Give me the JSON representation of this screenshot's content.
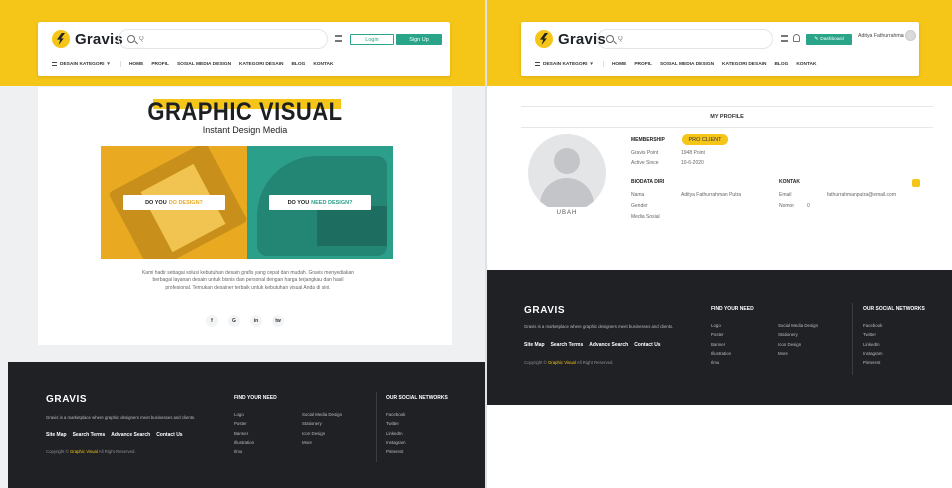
{
  "common": {
    "logo_text": "Gravis",
    "search_placeholder": "Q",
    "menu": {
      "category_label": "DESAIN KATEGORI",
      "items": [
        "HOME",
        "PROFIL",
        "SOSIAL MEDIA DESIGN",
        "KATEGORI DESAIN",
        "BLOG",
        "KONTAK"
      ]
    }
  },
  "left": {
    "header": {
      "login_label": "Login",
      "signup_label": "Sign Up"
    },
    "hero": {
      "title": "GRAPHIC VISUAL",
      "subtitle": "Instant Design Media",
      "tile_a_label": "DO YOU",
      "tile_a_accent": "DO DESIGN?",
      "tile_b_label": "DO YOU",
      "tile_b_accent": "NEED DESIGN?",
      "description": "Kami hadir sebagai solusi kebutuhan desain grafis yang cepat dan mudah. Gravis menyediakan berbagai layanan desain untuk bisnis dan personal dengan harga terjangkau dan hasil profesional. Temukan desainer terbaik untuk kebutuhan visual Anda di sini."
    },
    "socials": [
      "f",
      "G",
      "in",
      "tw"
    ],
    "footer": {
      "logo": "GRAVIS",
      "tagline": "Gravis is a marketplace where graphic designers meet businesses and clients.",
      "links": [
        "Site Map",
        "Search Terms",
        "Advance Search",
        "Contact Us"
      ],
      "copyright_prefix": "Copyright ©",
      "copyright_brand": "Graphic Visual",
      "copyright_suffix": "All Right Reserved.",
      "col_head": "FIND YOUR NEED",
      "col1": [
        "Logo",
        "Poster",
        "Banner",
        "Illustration",
        "Ilmu"
      ],
      "col2": [
        "Social Media Design",
        "Stationery",
        "Icon Design",
        "More"
      ],
      "social_head": "OUR SOCIAL NETWORKS",
      "social_list": [
        "Facebook",
        "Twitter",
        "LinkedIn",
        "Instagram",
        "Pinterest"
      ]
    }
  },
  "right": {
    "header": {
      "dashboard_label": "Dashboard",
      "username": "Aditya Fathurrahman Putra"
    },
    "profile": {
      "title": "MY PROFILE",
      "membership_label": "MEMBERSHIP",
      "membership_value": "PRO CLIENT",
      "row1_key": "Gravis Point",
      "row1_value": "1948 Point",
      "row2_key": "Active Since",
      "row2_value": "10-6-2020",
      "biodata_head": "BIODATA DIRI",
      "name_key": "Nama",
      "name_value": "Aditya Fathurrahman Putra",
      "gender_key": "Gender",
      "media_key": "Media Sosial",
      "contact_head": "KONTAK",
      "email_key": "Email",
      "email_value": "fathurrahmanputra@email.com",
      "phone_key": "Nomor",
      "phone_value": "0",
      "avatar_button": "UBAH"
    },
    "footer": {
      "logo": "GRAVIS",
      "tagline": "Gravis is a marketplace where graphic designers meet businesses and clients.",
      "links": [
        "Site Map",
        "Search Terms",
        "Advance Search",
        "Contact Us"
      ],
      "copyright_prefix": "Copyright ©",
      "copyright_brand": "Graphic Visual",
      "copyright_suffix": "All Right Reserved.",
      "col_head": "FIND YOUR NEED",
      "col1": [
        "Logo",
        "Poster",
        "Banner",
        "Illustration",
        "Ilmu"
      ],
      "col2": [
        "Social Media Design",
        "Stationery",
        "Icon Design",
        "More"
      ],
      "social_head": "OUR SOCIAL NETWORKS",
      "social_list": [
        "Facebook",
        "Twitter",
        "LinkedIn",
        "Instagram",
        "Pinterest"
      ]
    }
  },
  "colors": {
    "brand_yellow": "#f5c518",
    "accent_teal": "#2aa58a",
    "footer_bg": "#1f2125"
  }
}
